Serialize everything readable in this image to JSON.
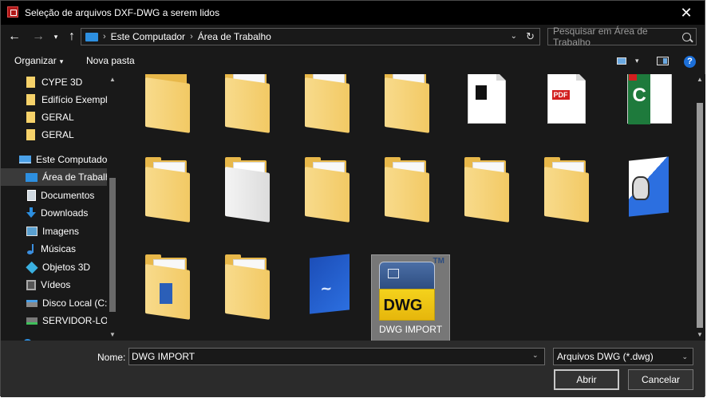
{
  "window": {
    "title": "Seleção de arquivos DXF-DWG a serem lidos",
    "close_glyph": "✕"
  },
  "nav": {
    "back_glyph": "←",
    "forward_glyph": "→",
    "recent_glyph": "▾",
    "up_glyph": "↑",
    "breadcrumb": [
      "Este Computador",
      "Área de Trabalho"
    ],
    "breadcrumb_sep": "›",
    "refresh_glyph": "↻",
    "dropdown_glyph": "⌄",
    "search_placeholder": "Pesquisar em Área de Trabalho"
  },
  "toolbar": {
    "organize_label": "Organizar",
    "organize_caret": "▾",
    "new_folder_label": "Nova pasta",
    "view_caret": "▾",
    "help_glyph": "?"
  },
  "sidebar": {
    "items": [
      {
        "label": "CYPE 3D",
        "icon": "folder-icon"
      },
      {
        "label": "Edifício Exemplo",
        "icon": "folder-icon"
      },
      {
        "label": "GERAL",
        "icon": "folder-icon"
      },
      {
        "label": "GERAL",
        "icon": "folder-icon"
      },
      {
        "label": "Este Computador",
        "icon": "computer-icon"
      },
      {
        "label": "Área de Trabalho",
        "icon": "desktop-icon",
        "selected": true
      },
      {
        "label": "Documentos",
        "icon": "documents-icon"
      },
      {
        "label": "Downloads",
        "icon": "downloads-icon"
      },
      {
        "label": "Imagens",
        "icon": "images-icon"
      },
      {
        "label": "Músicas",
        "icon": "music-icon"
      },
      {
        "label": "Objetos 3D",
        "icon": "objects-3d-icon"
      },
      {
        "label": "Vídeos",
        "icon": "videos-icon"
      },
      {
        "label": "Disco Local (C:)",
        "icon": "disk-icon"
      },
      {
        "label": "SERVIDOR-LOCK",
        "icon": "server-icon"
      }
    ],
    "scroll_up_glyph": "▲",
    "scroll_down_glyph": "▼"
  },
  "files": [
    {
      "kind": "folder-plain"
    },
    {
      "kind": "folder-docs"
    },
    {
      "kind": "folder-docs"
    },
    {
      "kind": "folder-docs"
    },
    {
      "kind": "document-black"
    },
    {
      "kind": "document-pdf",
      "badge": "PDF"
    },
    {
      "kind": "excel-file"
    },
    {
      "kind": "folder-docs"
    },
    {
      "kind": "folder-white"
    },
    {
      "kind": "folder-docs"
    },
    {
      "kind": "folder-docs"
    },
    {
      "kind": "folder-docs"
    },
    {
      "kind": "folder-docs"
    },
    {
      "kind": "app-face"
    },
    {
      "kind": "folder-word"
    },
    {
      "kind": "folder-docs"
    },
    {
      "kind": "blue-app"
    },
    {
      "kind": "dwg-import",
      "label": "DWG IMPORT",
      "logo_text": "DWG",
      "tm": "TM",
      "selected": true
    }
  ],
  "footer": {
    "name_label": "Nome:",
    "name_value": "DWG IMPORT",
    "dropdown_glyph": "⌄",
    "file_type": "Arquivos DWG (*.dwg)",
    "open_label": "Abrir",
    "cancel_label": "Cancelar"
  },
  "colors": {
    "background": "#191919",
    "titlebar": "#000000",
    "footer": "#2b2b2b",
    "accent_blue": "#2d8fe0",
    "folder_yellow": "#f2c964"
  }
}
